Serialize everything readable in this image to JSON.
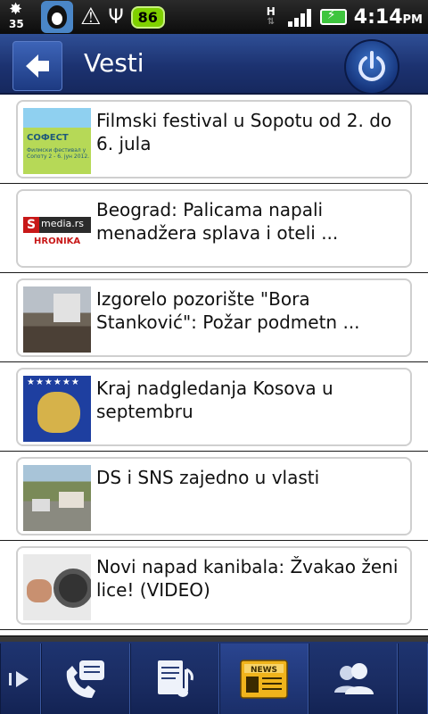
{
  "status_bar": {
    "weather_temp": "35",
    "battery_badge": "86",
    "network_type": "H",
    "time": "4:14",
    "ampm": "PM"
  },
  "header": {
    "title": "Vesti"
  },
  "news": [
    {
      "headline": "Filmski festival u Sopotu od 2. do 6. jula",
      "thumb_text": "СОФЕСТ",
      "thumb_sub": "Филмски фестивал у Сопоту 2 - 6. јун 2012."
    },
    {
      "headline": "Beograd: Palicama napali menadžera splava i oteli  ...",
      "thumb_s": "S",
      "thumb_media": "media.rs",
      "thumb_hronika": "HRONIKA"
    },
    {
      "headline": "Izgorelo pozorište \"Bora Stanković\": Požar podmetn ..."
    },
    {
      "headline": "Kraj nadgledanja Kosova u septembru",
      "thumb_stars": "★★★★★★"
    },
    {
      "headline": "DS i SNS zajedno u vlasti"
    },
    {
      "headline": "Novi napad kanibala: Žvakao ženi lice! (VIDEO)"
    }
  ],
  "dock": {
    "news_label": "NEWS"
  },
  "colors": {
    "header_blue": "#1c3270",
    "battery_green": "#7fd000"
  }
}
